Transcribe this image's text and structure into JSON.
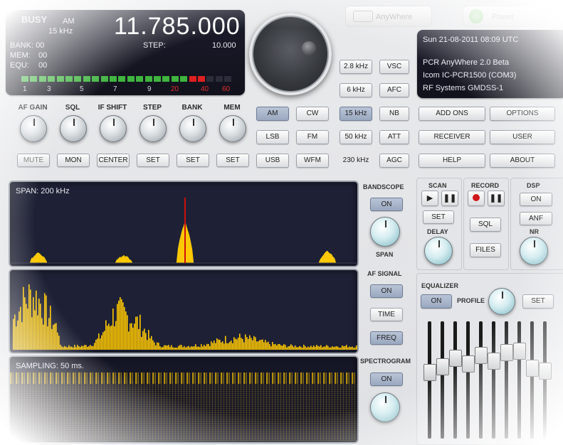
{
  "header": {
    "anywhere_label": "AnyWhere",
    "power_label": "Power"
  },
  "lcd_left": {
    "busy": "BUSY",
    "mode": "AM",
    "bandwidth": "15 kHz",
    "frequency": "11.785.000",
    "step_label": "STEP:",
    "step_value": "10.000",
    "bank_label": "BANK: 00",
    "mem_label": "MEM:",
    "mem_value": "00",
    "equ_label": "EQU:",
    "equ_value": "00",
    "scale": [
      "1",
      "3",
      "5",
      "7",
      "9",
      "20",
      "40",
      "60"
    ],
    "vu_green_segments": 19,
    "vu_red_segments": 2,
    "vu_total_segments": 24
  },
  "lcd_right": {
    "datetime": "Sun 21-08-2011 08:09 UTC",
    "app": "PCR AnyWhere 2.0 Beta",
    "device": "Icom IC-PCR1500 (COM3)",
    "station": "RF Systems GMDSS-1"
  },
  "knobs_row": [
    "AF GAIN",
    "SQL",
    "IF SHIFT",
    "STEP",
    "BANK",
    "MEM"
  ],
  "knob_buttons": [
    "MUTE",
    "MON",
    "CENTER",
    "SET",
    "SET",
    "SET"
  ],
  "mode_buttons": {
    "row1": [
      "AM",
      "CW",
      "15 kHz",
      "NB"
    ],
    "row2": [
      "LSB",
      "FM",
      "50 kHz",
      "ATT"
    ],
    "row3": [
      "USB",
      "WFM",
      "230 kHz",
      "AGC"
    ],
    "top_right": [
      "2.8 kHz",
      "VSC",
      "6 kHz",
      "AFC"
    ]
  },
  "menu_buttons": {
    "add_ons": "ADD ONS",
    "options": "OPTIONS",
    "receiver": "RECEIVER",
    "user": "USER",
    "help": "HELP",
    "about": "ABOUT"
  },
  "bandscope": {
    "span_text": "SPAN: 200 kHz",
    "title": "BANDSCOPE",
    "on": "ON",
    "span_label": "SPAN"
  },
  "af_signal": {
    "title": "AF SIGNAL",
    "on": "ON",
    "time": "TIME",
    "freq": "FREQ"
  },
  "spectrogram": {
    "sampling_text": "SAMPLING: 50 ms.",
    "title": "SPECTROGRAM",
    "on": "ON"
  },
  "scan": {
    "title": "SCAN",
    "set": "SET",
    "delay": "DELAY"
  },
  "record": {
    "title": "RECORD",
    "sql": "SQL",
    "files": "FILES"
  },
  "dsp": {
    "title": "DSP",
    "on": "ON",
    "anf": "ANF",
    "nr": "NR"
  },
  "equalizer": {
    "title": "EQUALIZER",
    "on": "ON",
    "profile": "PROFILE",
    "set": "SET"
  },
  "colors": {
    "display_bg": "#1e2135",
    "spectrum": "#ffc800",
    "marker": "#cc1010",
    "vu_green": "#3fb43f",
    "vu_red": "#e02020"
  }
}
